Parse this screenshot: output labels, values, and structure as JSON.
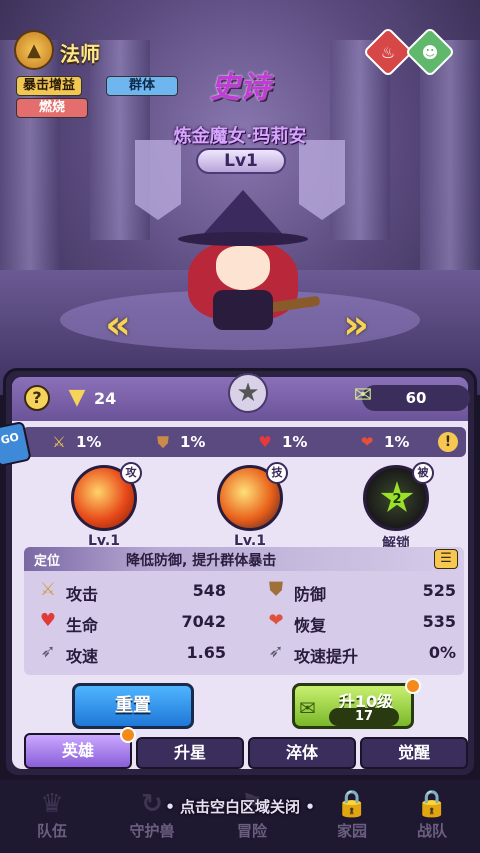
{
  "hero": {
    "class_name": "法师",
    "class_icon": "mage-emblem-icon",
    "tags": [
      "暴击增益",
      "群体",
      "燃烧"
    ],
    "rarity": "史诗",
    "name": "炼金魔女·玛莉安",
    "level": "Lv1",
    "elements": [
      "fire-element-icon",
      "beast-element-icon"
    ]
  },
  "panel": {
    "power": "24",
    "scrolls": "60",
    "bonuses": [
      {
        "icon": "sword-icon",
        "value": "1%"
      },
      {
        "icon": "shield-icon",
        "value": "1%"
      },
      {
        "icon": "heart-icon",
        "value": "1%"
      },
      {
        "icon": "heal-heart-icon",
        "value": "1%"
      }
    ],
    "skills": [
      {
        "badge": "攻",
        "label": "Lv.1"
      },
      {
        "badge": "技",
        "label": "Lv.1"
      },
      {
        "badge": "被",
        "label": "解锁",
        "star": "2"
      }
    ],
    "role": {
      "label": "定位",
      "desc": "降低防御, 提升群体暴击"
    },
    "stats": {
      "attack": {
        "label": "攻击",
        "value": "548"
      },
      "defense": {
        "label": "防御",
        "value": "525"
      },
      "hp": {
        "label": "生命",
        "value": "7042"
      },
      "recover": {
        "label": "恢复",
        "value": "535"
      },
      "atk_speed": {
        "label": "攻速",
        "value": "1.65"
      },
      "atk_speed_up": {
        "label": "攻速提升",
        "value": "0%"
      }
    },
    "buttons": {
      "reset": "重置",
      "upgrade": "升10级",
      "upgrade_cost": "17"
    },
    "tabs": [
      "英雄",
      "升星",
      "淬体",
      "觉醒"
    ],
    "active_tab": "英雄"
  },
  "close_hint": "• 点击空白区域关闭 •",
  "bottom_nav": [
    "队伍",
    "守护兽",
    "冒险",
    "家园",
    "战队"
  ]
}
